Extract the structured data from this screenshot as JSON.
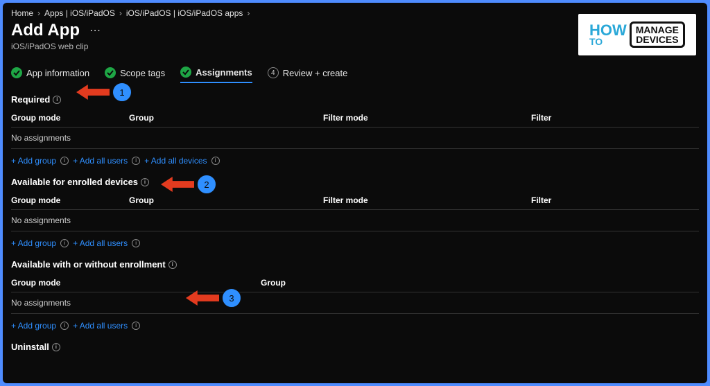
{
  "breadcrumbs": [
    "Home",
    "Apps | iOS/iPadOS",
    "iOS/iPadOS | iOS/iPadOS apps"
  ],
  "title": "Add App",
  "subtitle": "iOS/iPadOS web clip",
  "steps": {
    "s1": "App information",
    "s2": "Scope tags",
    "s3": "Assignments",
    "s4_num": "4",
    "s4": "Review + create"
  },
  "sections": {
    "required": {
      "title": "Required",
      "headers": {
        "groupmode": "Group mode",
        "group": "Group",
        "filtermode": "Filter mode",
        "filter": "Filter"
      },
      "empty": "No assignments",
      "actions": {
        "add_group": "+ Add group",
        "add_users": "+ Add all users",
        "add_devices": "+ Add all devices"
      }
    },
    "enrolled": {
      "title": "Available for enrolled devices",
      "headers": {
        "groupmode": "Group mode",
        "group": "Group",
        "filtermode": "Filter mode",
        "filter": "Filter"
      },
      "empty": "No assignments",
      "actions": {
        "add_group": "+ Add group",
        "add_users": "+ Add all users"
      }
    },
    "with_without": {
      "title": "Available with or without enrollment",
      "headers": {
        "groupmode": "Group mode",
        "group": "Group"
      },
      "empty": "No assignments",
      "actions": {
        "add_group": "+ Add group",
        "add_users": "+ Add all users"
      }
    },
    "uninstall": {
      "title": "Uninstall"
    }
  },
  "logo": {
    "how": "HOW",
    "to": "TO",
    "manage": "MANAGE",
    "devices": "DEVICES"
  },
  "annotations": {
    "n1": "1",
    "n2": "2",
    "n3": "3"
  }
}
